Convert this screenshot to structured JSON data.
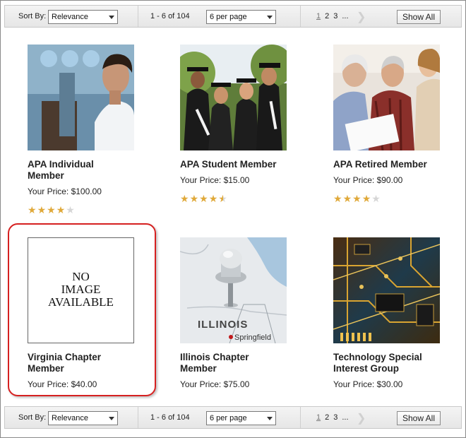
{
  "toolbar": {
    "sort_label": "Sort By:",
    "sort_value": "Relevance",
    "range_text": "1 - 6 of 104",
    "per_page_value": "6 per page",
    "pages": [
      "1",
      "2",
      "3",
      "..."
    ],
    "show_all": "Show All"
  },
  "products": [
    {
      "name_line1": "APA Individual",
      "name_line2": "Member",
      "price": "Your Price: $100.00",
      "rating": 4,
      "image": "man-profile-photo"
    },
    {
      "name_line1": "APA Student Member",
      "name_line2": "",
      "price": "Your Price: $15.00",
      "rating": 4.5,
      "image": "graduates-photo"
    },
    {
      "name_line1": "APA Retired Member",
      "name_line2": "",
      "price": "Your Price: $90.00",
      "rating": 4,
      "image": "seniors-photo"
    },
    {
      "name_line1": "Virginia Chapter",
      "name_line2": "Member",
      "price": "Your Price: $40.00",
      "image": "no-image-placeholder",
      "placeholder_lines": [
        "NO",
        "IMAGE",
        "AVAILABLE"
      ]
    },
    {
      "name_line1": "Illinois Chapter",
      "name_line2": "Member",
      "price": "Your Price: $75.00",
      "image": "illinois-map-pushpin-photo",
      "map_labels": [
        "ILLINOIS",
        "Springfield"
      ]
    },
    {
      "name_line1": "Technology Special",
      "name_line2": "Interest Group",
      "price": "Your Price: $30.00",
      "image": "circuit-board-photo"
    }
  ],
  "colors": {
    "star_on": "#e0a93a",
    "star_off": "#d6d6d6",
    "highlight": "#d62020"
  }
}
